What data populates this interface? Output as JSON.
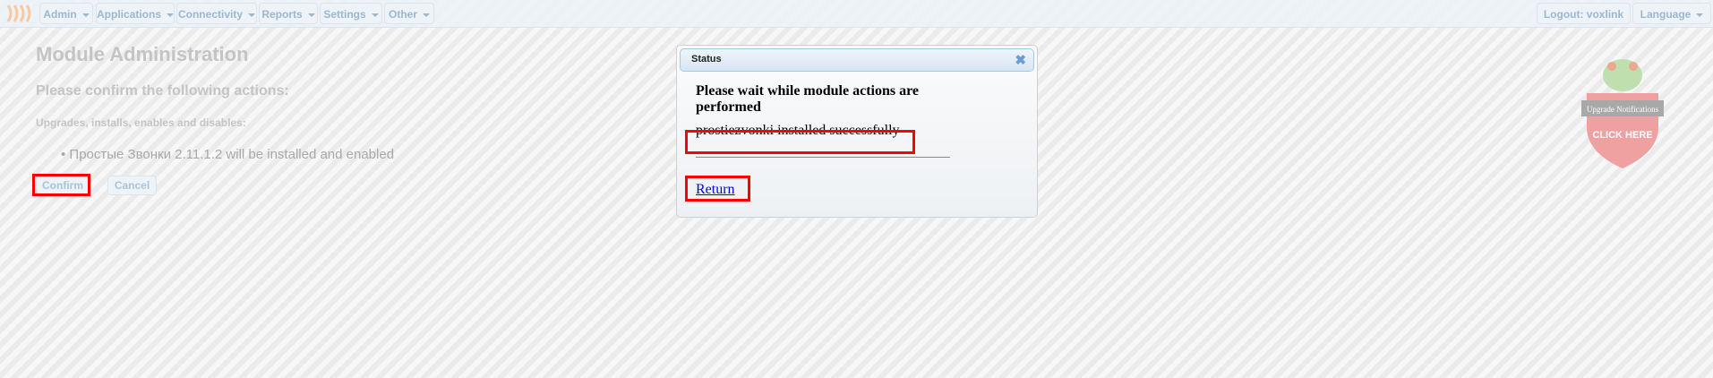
{
  "nav": {
    "menus": [
      "Admin",
      "Applications",
      "Connectivity",
      "Reports",
      "Settings",
      "Other"
    ],
    "logout": "Logout: voxlink",
    "language": "Language"
  },
  "page": {
    "title": "Module Administration",
    "confirm_heading": "Please confirm the following actions:",
    "section": "Upgrades, installs, enables and disables:",
    "actions": [
      "Простые Звонки 2.11.1.2 will be installed and enabled"
    ],
    "confirm_label": "Confirm",
    "cancel_label": "Cancel"
  },
  "badge": {
    "text_top": "Upgrade Notifications",
    "text_bottom": "CLICK HERE"
  },
  "dialog": {
    "title": "Status",
    "message": "Please wait while module actions are performed",
    "result": "prostiezvonki installed successfully",
    "return_label": "Return"
  },
  "colors": {
    "highlight": "#ff0000",
    "link": "#0000ee"
  }
}
